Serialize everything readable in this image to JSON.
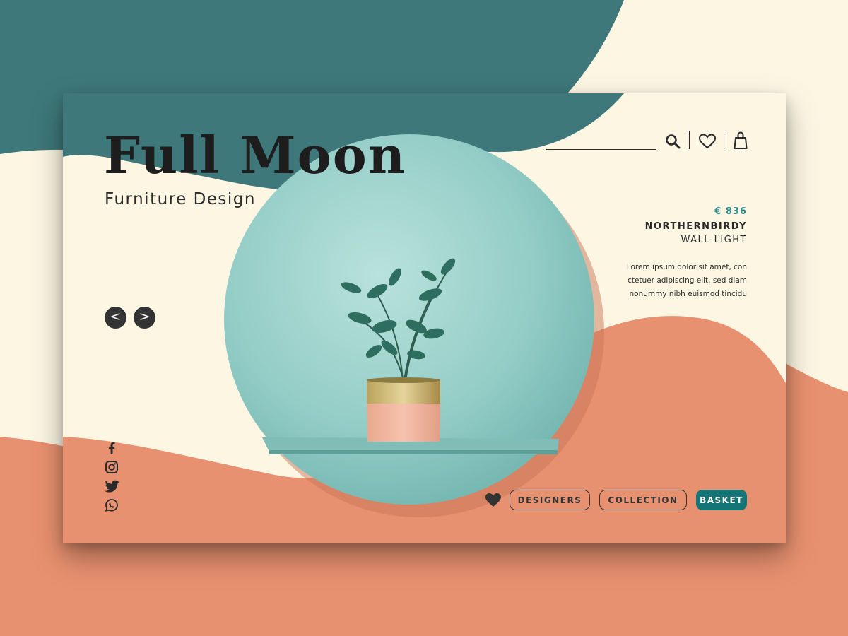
{
  "brand": {
    "title": "Full Moon",
    "subtitle": "Furniture Design"
  },
  "header": {
    "search_value": "",
    "icons": [
      "search-icon",
      "heart-icon",
      "shopping-bag-icon"
    ]
  },
  "product": {
    "price": "€ 836",
    "name": "NORTHERNBIRDY",
    "type": "WALL LIGHT",
    "description_lines": [
      "Lorem ipsum dolor sit amet, con",
      "ctetuer adipiscing elit, sed diam",
      "nonummy nibh euismod tincidu"
    ]
  },
  "nav": {
    "prev": "<",
    "next": ">"
  },
  "social": [
    "facebook-icon",
    "instagram-icon",
    "twitter-icon",
    "whatsapp-icon"
  ],
  "actions": {
    "designers": "DESIGNERS",
    "collection": "COLLECTION",
    "basket": "BASKET"
  },
  "colors": {
    "teal": "#3e787a",
    "cream": "#fdf6e3",
    "salmon": "#e89170",
    "accent": "#137575",
    "dark": "#333333"
  }
}
